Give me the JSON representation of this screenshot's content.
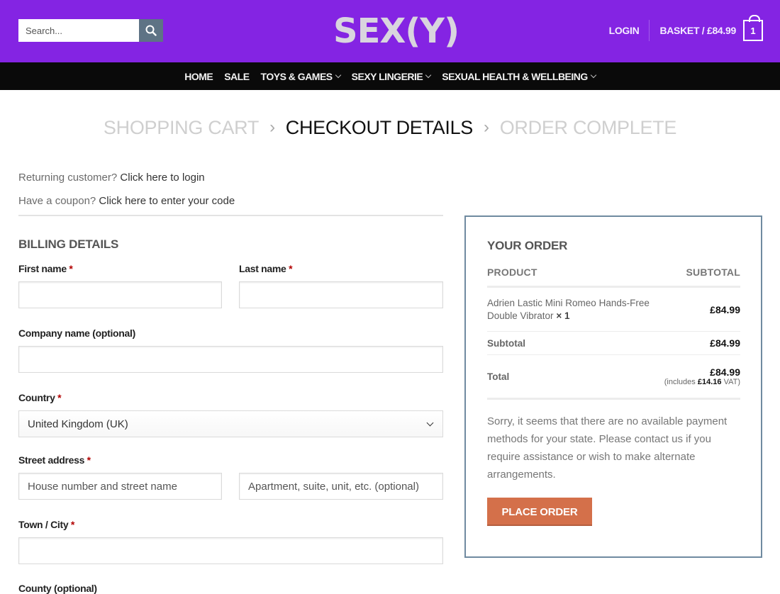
{
  "header": {
    "search_placeholder": "Search...",
    "logo_text": "SEX(Y)",
    "login_label": "LOGIN",
    "basket_label": "BASKET / £84.99",
    "cart_count": "1"
  },
  "nav": {
    "items": [
      {
        "label": "HOME",
        "has_dropdown": false
      },
      {
        "label": "SALE",
        "has_dropdown": false
      },
      {
        "label": "TOYS & GAMES",
        "has_dropdown": true
      },
      {
        "label": "SEXY LINGERIE",
        "has_dropdown": true
      },
      {
        "label": "SEXUAL HEALTH & WELLBEING",
        "has_dropdown": true
      }
    ]
  },
  "steps": {
    "cart": "SHOPPING CART",
    "checkout": "CHECKOUT DETAILS",
    "complete": "ORDER COMPLETE"
  },
  "notices": {
    "returning_text": "Returning customer?",
    "returning_link": "Click here to login",
    "coupon_text": "Have a coupon?",
    "coupon_link": "Click here to enter your code"
  },
  "billing": {
    "title": "BILLING DETAILS",
    "first_name_label": "First name",
    "last_name_label": "Last name",
    "company_label": "Company name (optional)",
    "country_label": "Country",
    "country_value": "United Kingdom (UK)",
    "street_label": "Street address",
    "street_placeholder_1": "House number and street name",
    "street_placeholder_2": "Apartment, suite, unit, etc. (optional)",
    "town_label": "Town / City",
    "county_label": "County (optional)",
    "required_mark": "*"
  },
  "order": {
    "title": "YOUR ORDER",
    "col_product": "PRODUCT",
    "col_subtotal": "SUBTOTAL",
    "item_name": "Adrien Lastic Mini Romeo Hands-Free Double Vibrator",
    "item_qty": "× 1",
    "item_price": "£84.99",
    "subtotal_label": "Subtotal",
    "subtotal_value": "£84.99",
    "total_label": "Total",
    "total_value": "£84.99",
    "vat_prefix": "(includes",
    "vat_amount": "£14.16",
    "vat_suffix": "VAT)",
    "payment_message": "Sorry, it seems that there are no available payment methods for your state. Please contact us if you require assistance or wish to make alternate arrangements.",
    "place_order_label": "PLACE ORDER"
  },
  "colors": {
    "header_bg": "#8424e3",
    "nav_bg": "#0a0a0a",
    "button_accent": "#d4704a",
    "order_border": "#6f8aa0",
    "required": "#b20000"
  }
}
